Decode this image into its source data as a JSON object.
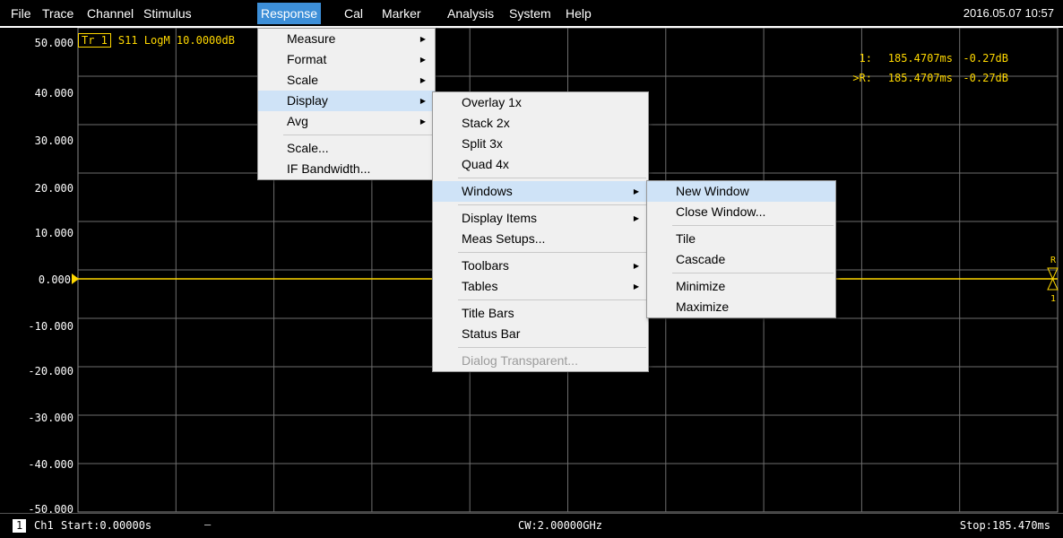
{
  "menubar": {
    "items": [
      {
        "label": "File"
      },
      {
        "label": "Trace"
      },
      {
        "label": "Channel"
      },
      {
        "label": "Stimulus"
      },
      {
        "label": "Response",
        "active": true
      },
      {
        "label": "Cal"
      },
      {
        "label": "Marker"
      },
      {
        "label": "Analysis"
      },
      {
        "label": "System"
      },
      {
        "label": "Help"
      }
    ],
    "datetime": "2016.05.07 10:57"
  },
  "trace": {
    "tag": "Tr 1",
    "info": "S11 LogM 10.0000dB"
  },
  "y_axis": {
    "labels": [
      "50.000",
      "40.000",
      "30.000",
      "20.000",
      "10.000",
      "0.000",
      "-10.000",
      "-20.000",
      "-30.000",
      "-40.000",
      "-50.000"
    ]
  },
  "markers": [
    {
      "id": "1:",
      "x": "185.4707ms",
      "y": "-0.27dB"
    },
    {
      "id": ">R:",
      "x": "185.4707ms",
      "y": "-0.27dB"
    }
  ],
  "status": {
    "channel_number": "1",
    "channel_label": "Ch1",
    "start": "Start:0.00000s",
    "dash": "—",
    "cw": "CW:2.00000GHz",
    "stop": "Stop:185.470ms"
  },
  "response_menu": {
    "items": [
      {
        "label": "Measure",
        "submenu": true
      },
      {
        "label": "Format",
        "submenu": true
      },
      {
        "label": "Scale",
        "submenu": true
      },
      {
        "label": "Display",
        "submenu": true,
        "highlighted": true
      },
      {
        "label": "Avg",
        "submenu": true
      },
      {
        "separator": true
      },
      {
        "label": "Scale..."
      },
      {
        "label": "IF Bandwidth..."
      }
    ]
  },
  "display_menu": {
    "items": [
      {
        "label": "Overlay 1x"
      },
      {
        "label": "Stack 2x"
      },
      {
        "label": "Split 3x"
      },
      {
        "label": "Quad 4x"
      },
      {
        "separator": true
      },
      {
        "label": "Windows",
        "submenu": true,
        "highlighted": true
      },
      {
        "separator": true
      },
      {
        "label": "Display Items",
        "submenu": true
      },
      {
        "label": "Meas Setups..."
      },
      {
        "separator": true
      },
      {
        "label": "Toolbars",
        "submenu": true
      },
      {
        "label": "Tables",
        "submenu": true
      },
      {
        "separator": true
      },
      {
        "label": "Title Bars"
      },
      {
        "label": "Status Bar"
      },
      {
        "separator": true
      },
      {
        "label": "Dialog Transparent...",
        "disabled": true
      }
    ]
  },
  "windows_menu": {
    "items": [
      {
        "label": "New Window",
        "highlighted": true
      },
      {
        "label": "Close Window..."
      },
      {
        "separator": true
      },
      {
        "label": "Tile"
      },
      {
        "label": "Cascade"
      },
      {
        "separator": true
      },
      {
        "label": "Minimize"
      },
      {
        "label": "Maximize"
      }
    ]
  },
  "colors": {
    "trace": "#ffd800",
    "grid": "#8a8a8a",
    "menu_active": "#3d8fd8",
    "menu_highlight": "#cfe3f7"
  }
}
